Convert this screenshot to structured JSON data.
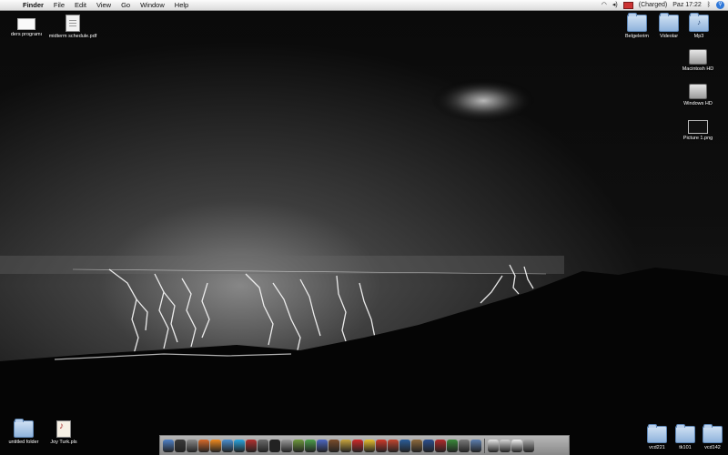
{
  "menubar": {
    "app_name": "Finder",
    "menus": [
      "File",
      "Edit",
      "View",
      "Go",
      "Window",
      "Help"
    ],
    "battery_text": "(Charged)",
    "clock": "Paz 17:22",
    "status_icons": [
      "wifi-icon",
      "volume-icon",
      "battery-icon",
      "bluetooth-icon",
      "spotlight-icon"
    ]
  },
  "desktop": {
    "icons_top_left": [
      {
        "label": "ders programı",
        "icon": "document-icon"
      },
      {
        "label": "midterm schedule.pdf",
        "icon": "pdf-document-icon"
      }
    ],
    "icons_top_right": [
      {
        "label": "Belgelerim",
        "icon": "folder-icon"
      },
      {
        "label": "Videolar",
        "icon": "folder-icon"
      },
      {
        "label": "Mp3",
        "icon": "music-folder-icon"
      },
      {
        "label": "Macintosh HD",
        "icon": "hard-drive-icon"
      },
      {
        "label": "Windows HD",
        "icon": "hard-drive-icon"
      },
      {
        "label": "Picture 1.png",
        "icon": "image-file-icon"
      }
    ],
    "icons_bottom_left": [
      {
        "label": "untitled folder",
        "icon": "folder-icon"
      },
      {
        "label": "Joy Turk.pls",
        "icon": "playlist-file-icon"
      }
    ],
    "icons_bottom_right": [
      {
        "label": "vcd221",
        "icon": "folder-icon"
      },
      {
        "label": "tk101",
        "icon": "folder-icon"
      },
      {
        "label": "vcd142",
        "icon": "folder-icon"
      }
    ]
  },
  "wallpaper": {
    "subject": "lightning-storm-wallpaper"
  },
  "dock": {
    "apps": [
      {
        "icon": "finder-icon",
        "color": "#4f82c9"
      },
      {
        "icon": "dashboard-icon",
        "color": "#3a3a3a"
      },
      {
        "icon": "system-preferences-icon",
        "color": "#8a8a8a"
      },
      {
        "icon": "firefox-icon",
        "color": "#d86a2a"
      },
      {
        "icon": "vlc-icon",
        "color": "#f08a1e"
      },
      {
        "icon": "safari-icon",
        "color": "#4a8fd0"
      },
      {
        "icon": "skype-icon",
        "color": "#2aa6e0"
      },
      {
        "icon": "photobooth-icon",
        "color": "#b3312f"
      },
      {
        "icon": "iphoto-icon",
        "color": "#6a6a6a"
      },
      {
        "icon": "terminal-icon",
        "color": "#222222"
      },
      {
        "icon": "preview-icon",
        "color": "#9a9a9a"
      },
      {
        "icon": "calculator-icon",
        "color": "#6f9a3c"
      },
      {
        "icon": "adium-icon",
        "color": "#4ca04a"
      },
      {
        "icon": "itunes-icon",
        "color": "#4d67c2"
      },
      {
        "icon": "transmission-icon",
        "color": "#7b4d2b"
      },
      {
        "icon": "textedit-icon",
        "color": "#c8a43d"
      },
      {
        "icon": "stop-icon",
        "color": "#d02a2a"
      },
      {
        "icon": "ical-icon",
        "color": "#e9c130"
      },
      {
        "icon": "chrome-icon",
        "color": "#d03a2a"
      },
      {
        "icon": "address-book-icon",
        "color": "#c2452f"
      },
      {
        "icon": "photoshop-icon",
        "color": "#2b5d99"
      },
      {
        "icon": "aperture-icon",
        "color": "#8e6a3d"
      },
      {
        "icon": "globe-icon",
        "color": "#2c4f8f"
      },
      {
        "icon": "acrobat-icon",
        "color": "#b22b2b"
      },
      {
        "icon": "utility-icon",
        "color": "#3a8a3a"
      },
      {
        "icon": "disk-utility-icon",
        "color": "#7a7a7a"
      },
      {
        "icon": "mail-icon",
        "color": "#5d7fb0"
      }
    ],
    "others": [
      {
        "icon": "applications-stack-icon",
        "color": "#e8e8e8"
      },
      {
        "icon": "documents-stack-icon",
        "color": "#d8d8d8"
      },
      {
        "icon": "downloads-stack-icon",
        "color": "#f4f4f4"
      },
      {
        "icon": "trash-icon",
        "color": "#a9a9a9"
      }
    ]
  }
}
